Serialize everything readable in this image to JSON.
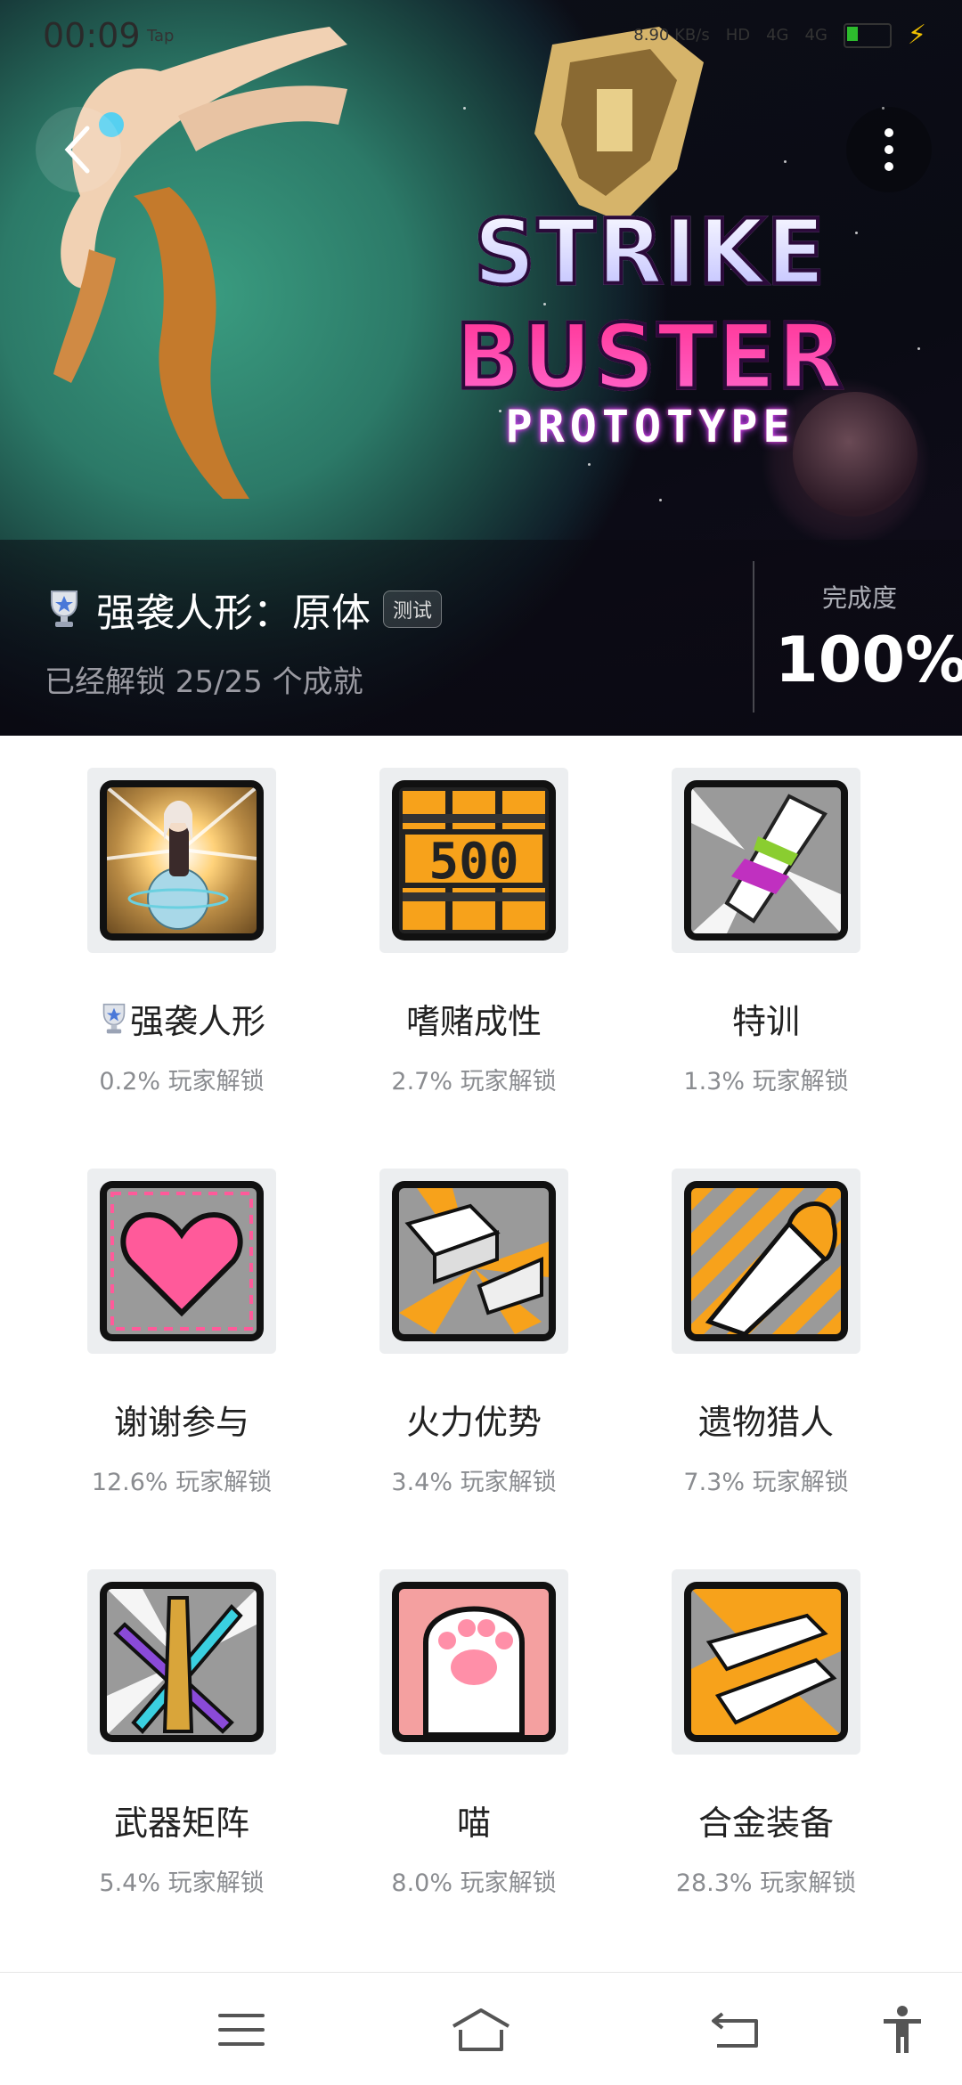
{
  "status_bar": {
    "time": "00:09",
    "left_icons": "Tap",
    "network_speed": "8.90 KB/s",
    "signal_labels": [
      "HD",
      "4G",
      "4G"
    ],
    "battery_label": "battery"
  },
  "header": {
    "back_icon": "chevron-left-icon",
    "more_icon": "more-vertical-icon",
    "logo_main": "STRIKE BUSTER",
    "logo_sub": "PROTOTYPE"
  },
  "game": {
    "title": "强袭人形：原体",
    "tag": "测试",
    "unlocked_text": "已经解锁 25/25 个成就",
    "completion_label": "完成度",
    "completion_value": "100%"
  },
  "achievements": [
    {
      "name": "强袭人形",
      "rate": "0.2% 玩家解锁",
      "rare": true
    },
    {
      "name": "嗜赌成性",
      "rate": "2.7% 玩家解锁",
      "rare": false
    },
    {
      "name": "特训",
      "rate": "1.3% 玩家解锁",
      "rare": false
    },
    {
      "name": "谢谢参与",
      "rate": "12.6% 玩家解锁",
      "rare": false
    },
    {
      "name": "火力优势",
      "rate": "3.4% 玩家解锁",
      "rare": false
    },
    {
      "name": "遗物猎人",
      "rate": "7.3% 玩家解锁",
      "rare": false
    },
    {
      "name": "武器矩阵",
      "rate": "5.4% 玩家解锁",
      "rare": false
    },
    {
      "name": "喵",
      "rate": "8.0% 玩家解锁",
      "rare": false
    },
    {
      "name": "合金装备",
      "rate": "28.3% 玩家解锁",
      "rare": false
    }
  ],
  "icon_texts": {
    "slot_number": "500"
  },
  "nav": {
    "menu_icon": "menu-icon",
    "home_icon": "home-icon",
    "back_icon": "return-icon",
    "accessibility_icon": "accessibility-icon"
  },
  "colors": {
    "accent_pink": "#ff3c9e",
    "heart": "#ff5a9a",
    "orange": "#f7a21b"
  }
}
